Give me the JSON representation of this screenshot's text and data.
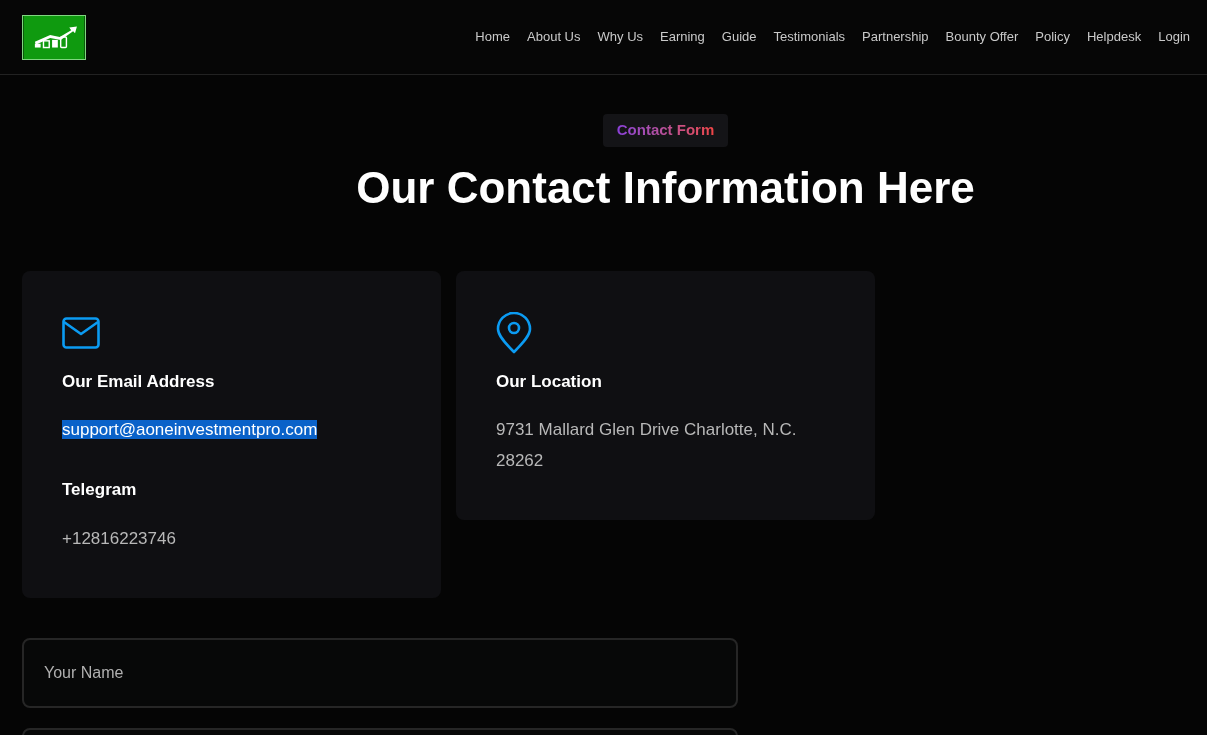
{
  "nav": {
    "items": [
      {
        "label": "Home"
      },
      {
        "label": "About Us"
      },
      {
        "label": "Why Us"
      },
      {
        "label": "Earning"
      },
      {
        "label": "Guide"
      },
      {
        "label": "Testimonials"
      },
      {
        "label": "Partnership"
      },
      {
        "label": "Bounty Offer"
      },
      {
        "label": "Policy"
      },
      {
        "label": "Helpdesk"
      },
      {
        "label": "Login"
      }
    ]
  },
  "section": {
    "badge": "Contact Form",
    "title": "Our Contact Information Here"
  },
  "cards": [
    {
      "kind": "mail",
      "items": [
        {
          "heading": "Our Email Address",
          "value": "support@aoneinvestmentpro.com",
          "highlighted": true
        },
        {
          "heading": "Telegram",
          "value": "+12816223746",
          "highlighted": false
        }
      ]
    },
    {
      "kind": "pin",
      "items": [
        {
          "heading": "Our Location",
          "value": "9731 Mallard Glen Drive Charlotte, N.C. 28262",
          "highlighted": false
        }
      ]
    }
  ],
  "form": {
    "fields": [
      {
        "kind": "text",
        "placeholder": "Your Name"
      },
      {
        "kind": "text"
      }
    ]
  }
}
